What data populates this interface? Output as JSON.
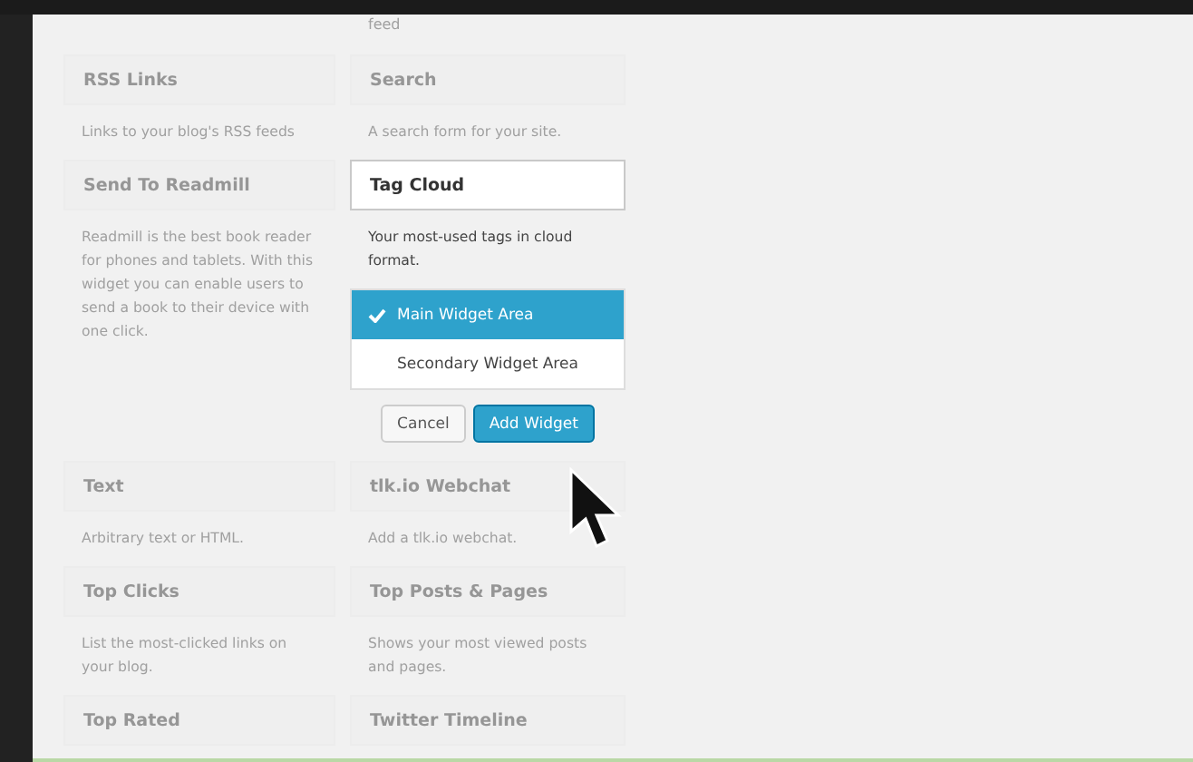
{
  "top_fragment": "feed",
  "widgets": [
    {
      "title": "RSS Links",
      "description": "Links to your blog's RSS feeds",
      "selected": false
    },
    {
      "title": "Search",
      "description": "A search form for your site.",
      "selected": false
    },
    {
      "title": "Send To Readmill",
      "description": "Readmill is the best book reader for phones and tablets. With this widget you can enable users to send a book to their device with one click.",
      "selected": false
    },
    {
      "title": "Tag Cloud",
      "description": "Your most-used tags in cloud format.",
      "selected": true,
      "areas": [
        {
          "label": "Main Widget Area",
          "selected": true
        },
        {
          "label": "Secondary Widget Area",
          "selected": false
        }
      ],
      "buttons": [
        {
          "label": "Cancel",
          "kind": "secondary"
        },
        {
          "label": "Add Widget",
          "kind": "primary"
        }
      ]
    },
    {
      "title": "Text",
      "description": "Arbitrary text or HTML.",
      "selected": false
    },
    {
      "title": "tlk.io Webchat",
      "description": "Add a tlk.io webchat.",
      "selected": false
    },
    {
      "title": "Top Clicks",
      "description": "List the most-clicked links on your blog.",
      "selected": false
    },
    {
      "title": "Top Posts & Pages",
      "description": "Shows your most viewed posts and pages.",
      "selected": false
    },
    {
      "title": "Top Rated",
      "selected": false
    },
    {
      "title": "Twitter Timeline",
      "selected": false
    }
  ]
}
